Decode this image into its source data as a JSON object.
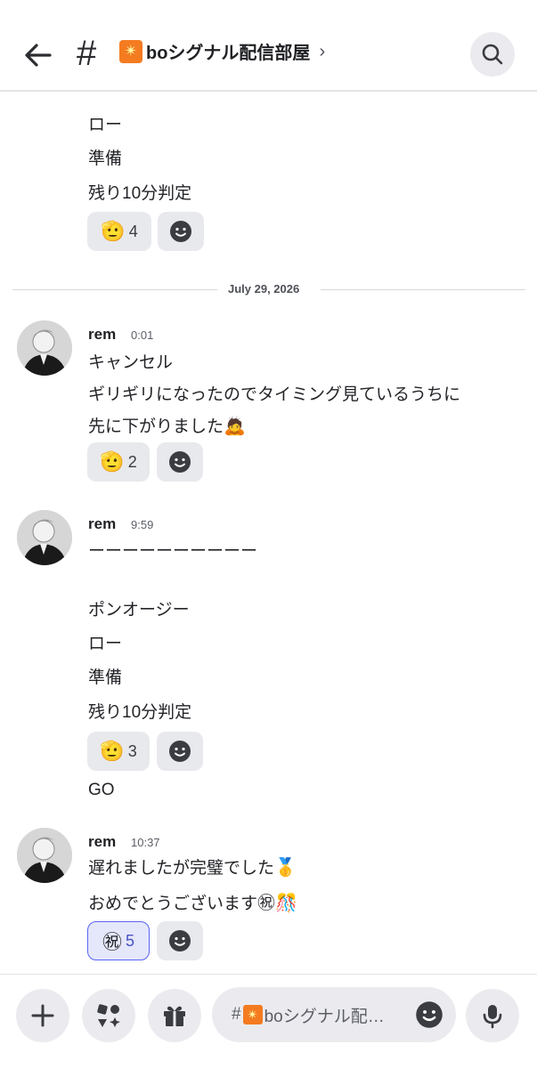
{
  "header": {
    "hash": "#",
    "channel_badge": "✴",
    "channel_name": "boシグナル配信部屋",
    "chevron": "›"
  },
  "top_partial": {
    "lines": [
      "ロー",
      "準備",
      "残り10分判定"
    ],
    "reaction_emoji": "🫡",
    "reaction_count": "4"
  },
  "date_divider": "July 29, 2026",
  "messages": [
    {
      "author": "rem",
      "time": "0:01",
      "lines": [
        "キャンセル",
        "ギリギリになったのでタイミング見ているうちに",
        "先に下がりました"
      ],
      "trailing_emoji": "🙇",
      "reaction_emoji": "🫡",
      "reaction_count": "2"
    },
    {
      "author": "rem",
      "time": "9:59",
      "lines": [
        "ーーーーーーーーーー",
        "ポンオージー",
        "ロー",
        "準備",
        "残り10分判定"
      ],
      "reaction_emoji": "🫡",
      "reaction_count": "3",
      "followup": "GO"
    },
    {
      "author": "rem",
      "time": "10:37",
      "lines": [
        "遅れましたが完璧でした",
        "おめでとうございます"
      ],
      "line1_emoji": "🥇",
      "line2_emoji": "㊗🎊",
      "reaction_emoji": "㊗",
      "reaction_count": "5"
    }
  ],
  "composer": {
    "placeholder_prefix": "#",
    "placeholder_badge": "✴",
    "placeholder_text": "boシグナル配…"
  },
  "icons": {
    "back": "arrow-left-icon",
    "search": "search-icon",
    "add": "plus-icon",
    "apps": "apps-icon",
    "gift": "gift-icon",
    "emoji": "smiley-icon",
    "mic": "microphone-icon"
  },
  "colors": {
    "accent": "#5865f2",
    "badge": "#f47b20",
    "pill": "#e8e9ed"
  }
}
